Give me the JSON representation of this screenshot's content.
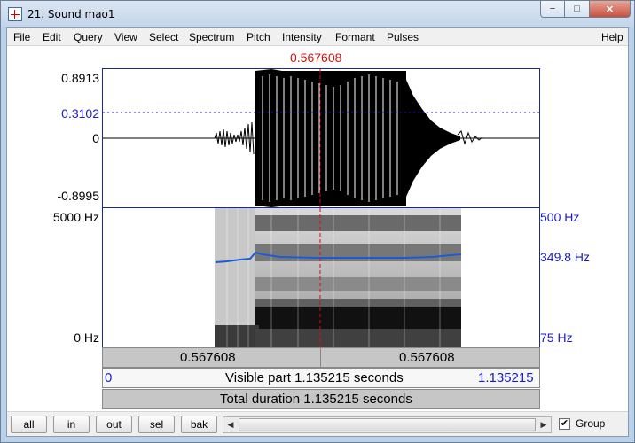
{
  "window": {
    "title": "21. Sound mao1",
    "min_glyph": "−",
    "max_glyph": "□",
    "close_glyph": "✕"
  },
  "menu": [
    "File",
    "Edit",
    "Query",
    "View",
    "Select",
    "Spectrum",
    "Pitch",
    "Intensity",
    "Formant",
    "Pulses",
    "Help"
  ],
  "cursor_time": "0.567608",
  "waveform": {
    "max_label": "0.8913",
    "cursor_value": "0.3102",
    "zero_label": "0",
    "min_label": "-0.8995"
  },
  "spectrogram": {
    "top_freq": "5000 Hz",
    "bottom_freq": "0 Hz",
    "pitch_top": "500 Hz",
    "pitch_value": "349.8 Hz",
    "pitch_bottom": "75 Hz"
  },
  "bars": {
    "left_part": "0.567608",
    "right_part": "0.567608",
    "visible_start": "0",
    "visible_text": "Visible part 1.135215 seconds",
    "visible_end": "1.135215",
    "total_text": "Total duration 1.135215 seconds"
  },
  "buttons": [
    "all",
    "in",
    "out",
    "sel",
    "bak"
  ],
  "scroll": {
    "left_arrow": "◀",
    "right_arrow": "▶"
  },
  "group": {
    "label": "Group",
    "checked_glyph": "✔"
  },
  "colors": {
    "cursor": "#d01010",
    "pitch": "#1a5cd6",
    "axis_blue": "#1a1ac8"
  }
}
